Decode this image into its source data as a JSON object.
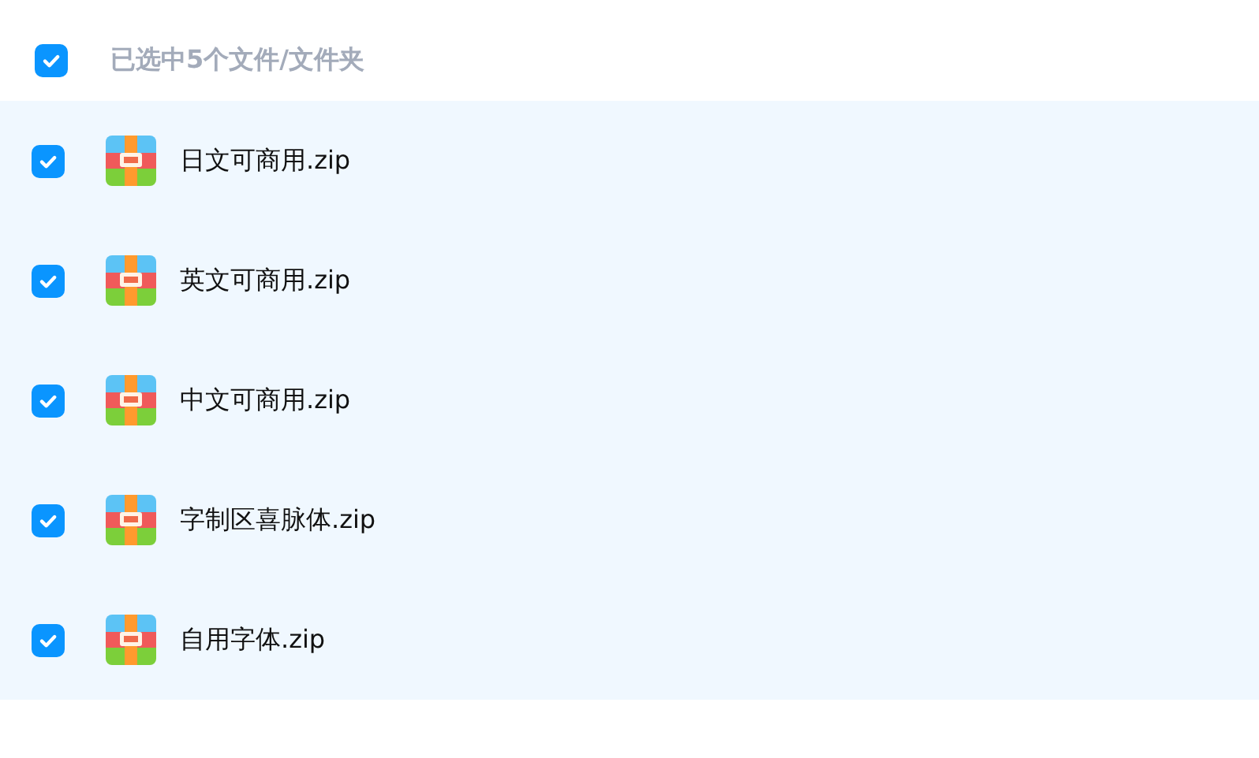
{
  "header": {
    "checked": true,
    "label": "已选中5个文件/文件夹"
  },
  "files": [
    {
      "name": "日文可商用.zip",
      "selected": true
    },
    {
      "name": "英文可商用.zip",
      "selected": true
    },
    {
      "name": "中文可商用.zip",
      "selected": true
    },
    {
      "name": "字制区喜脉体.zip",
      "selected": true
    },
    {
      "name": "自用字体.zip",
      "selected": true
    }
  ]
}
